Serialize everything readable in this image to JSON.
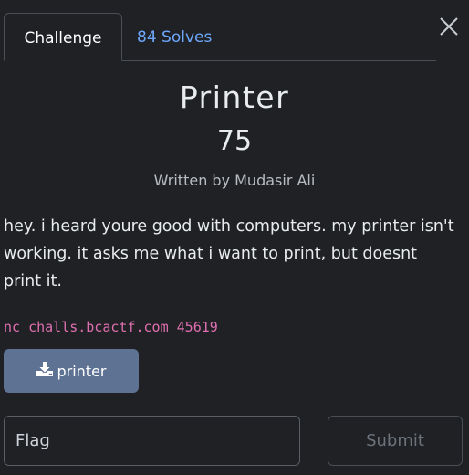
{
  "tabs": [
    {
      "label": "Challenge",
      "active": true
    },
    {
      "label": "84 Solves",
      "active": false
    }
  ],
  "challenge": {
    "name": "Printer",
    "points": "75",
    "author": "Written by Mudasir Ali",
    "description": "hey. i heard youre good with computers. my printer isn't working. it asks me what i want to print, but doesnt print it.",
    "connection": "nc challs.bcactf.com 45619",
    "file_label": "printer"
  },
  "form": {
    "flag_placeholder": "Flag",
    "flag_value": "",
    "submit_label": "Submit"
  },
  "icons": {
    "close": "close-icon",
    "download": "download-icon"
  },
  "colors": {
    "background": "#1f2125",
    "link": "#6ea8fe",
    "download_button": "#5e7393",
    "connection_text": "#e06fb0"
  }
}
